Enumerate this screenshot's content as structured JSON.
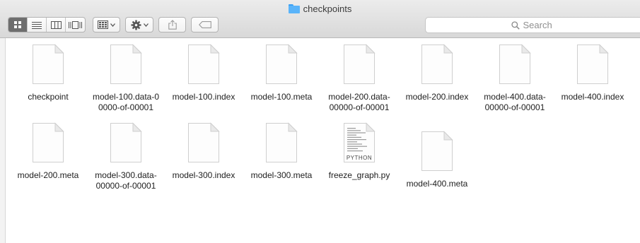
{
  "window": {
    "title": "checkpoints"
  },
  "toolbar": {
    "view_buttons": [
      "icon-view",
      "list-view",
      "column-view",
      "cover-flow-view"
    ],
    "arrange_icon": "arrange-grid-icon",
    "action_icon": "gear-icon",
    "share_icon": "share-icon",
    "tag_icon": "tag-icon"
  },
  "search": {
    "placeholder": "Search"
  },
  "files": [
    {
      "name": "checkpoint",
      "lines": [
        "checkpoint"
      ],
      "kind": "blank"
    },
    {
      "name": "model-100.data-00000-of-00001",
      "lines": [
        "model-100.data-0",
        "0000-of-00001"
      ],
      "kind": "blank"
    },
    {
      "name": "model-100.index",
      "lines": [
        "model-100.index"
      ],
      "kind": "blank"
    },
    {
      "name": "model-100.meta",
      "lines": [
        "model-100.meta"
      ],
      "kind": "blank"
    },
    {
      "name": "model-200.data-00000-of-00001",
      "lines": [
        "model-200.data-",
        "00000-of-00001"
      ],
      "kind": "blank"
    },
    {
      "name": "model-200.index",
      "lines": [
        "model-200.index"
      ],
      "kind": "blank"
    },
    {
      "name": "model-400.data-00000-of-00001",
      "lines": [
        "model-400.data-",
        "00000-of-00001"
      ],
      "kind": "blank"
    },
    {
      "name": "model-400.index",
      "lines": [
        "model-400.index"
      ],
      "kind": "blank"
    },
    {
      "name": "model-200.meta",
      "lines": [
        "model-200.meta"
      ],
      "kind": "blank"
    },
    {
      "name": "model-300.data-00000-of-00001",
      "lines": [
        "model-300.data-",
        "00000-of-00001"
      ],
      "kind": "blank"
    },
    {
      "name": "model-300.index",
      "lines": [
        "model-300.index"
      ],
      "kind": "blank"
    },
    {
      "name": "model-300.meta",
      "lines": [
        "model-300.meta"
      ],
      "kind": "blank"
    },
    {
      "name": "freeze_graph.py",
      "lines": [
        "freeze_graph.py"
      ],
      "kind": "python",
      "badge": "PYTHON"
    },
    {
      "name": "model-400.meta",
      "lines": [
        "model-400.meta"
      ],
      "kind": "blank"
    }
  ],
  "colors": {
    "folder": "#5ab4fa",
    "selected_segment": "#6e6e6e"
  }
}
